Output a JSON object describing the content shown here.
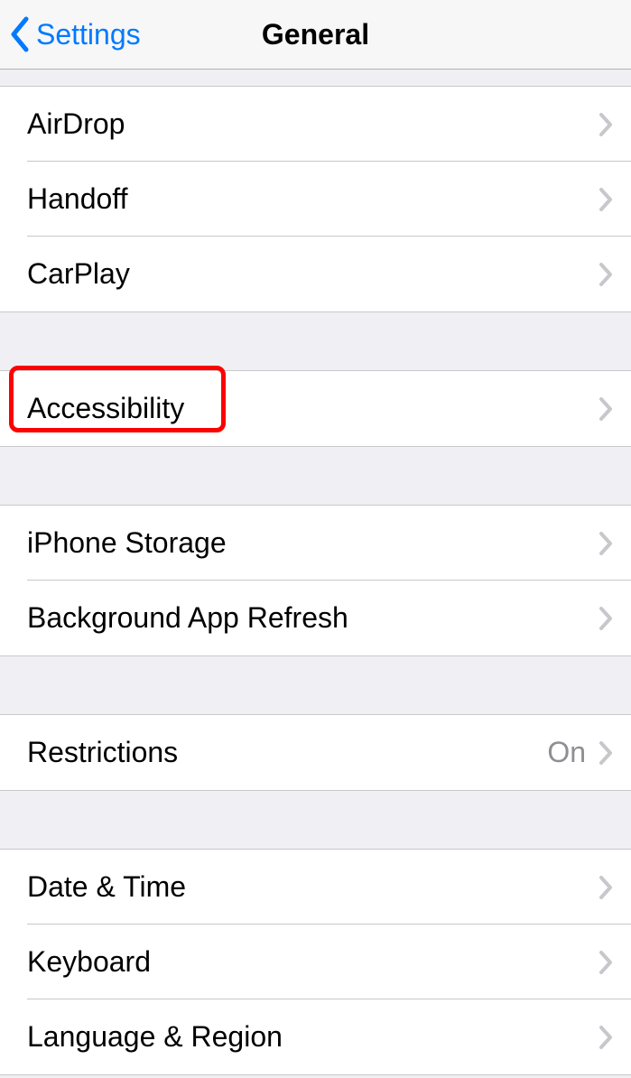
{
  "nav": {
    "back_label": "Settings",
    "title": "General"
  },
  "sections": [
    {
      "rows": [
        {
          "label": "AirDrop",
          "value": ""
        },
        {
          "label": "Handoff",
          "value": ""
        },
        {
          "label": "CarPlay",
          "value": ""
        }
      ]
    },
    {
      "rows": [
        {
          "label": "Accessibility",
          "value": "",
          "highlighted": true
        }
      ]
    },
    {
      "rows": [
        {
          "label": "iPhone Storage",
          "value": ""
        },
        {
          "label": "Background App Refresh",
          "value": ""
        }
      ]
    },
    {
      "rows": [
        {
          "label": "Restrictions",
          "value": "On"
        }
      ]
    },
    {
      "rows": [
        {
          "label": "Date & Time",
          "value": ""
        },
        {
          "label": "Keyboard",
          "value": ""
        },
        {
          "label": "Language & Region",
          "value": ""
        }
      ]
    }
  ]
}
